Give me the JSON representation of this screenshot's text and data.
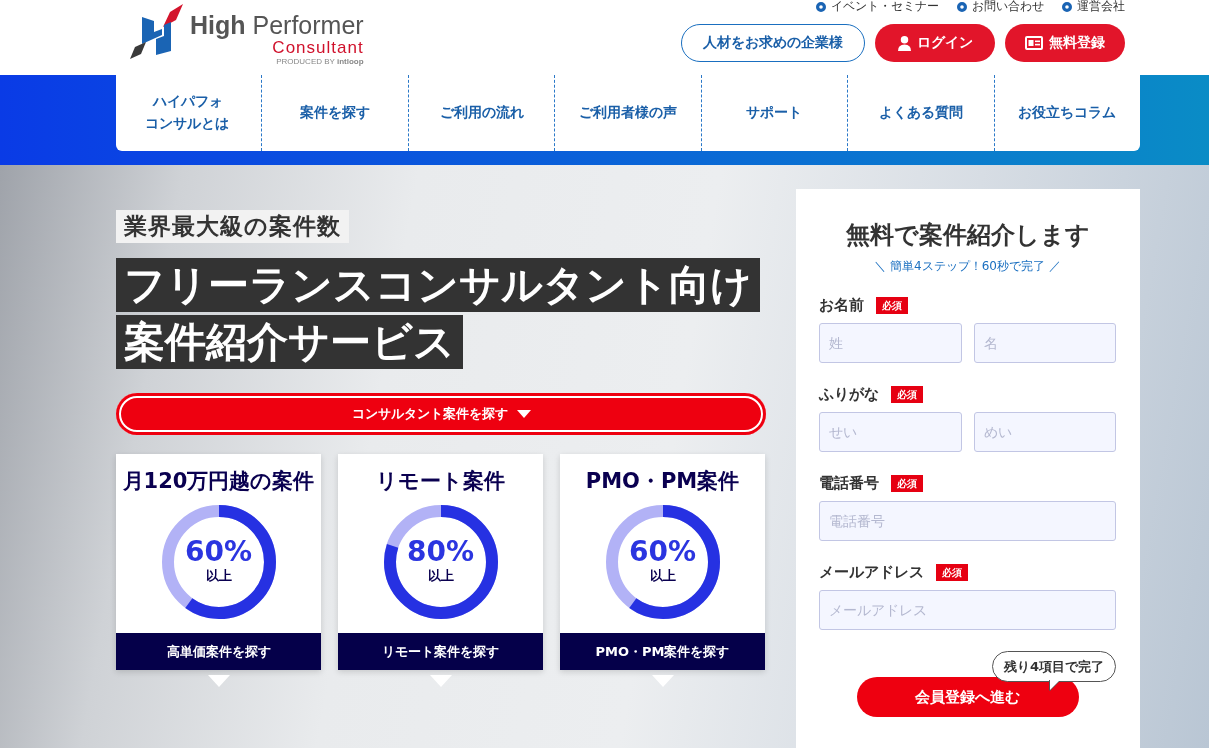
{
  "header": {
    "logo": {
      "wordmark": "**High** Performer",
      "tagline": "Consultant",
      "credit": "PRODUCED BY **intloop**"
    },
    "utility_links": [
      "イベント・セミナー",
      "お問い合わせ",
      "運営会社"
    ],
    "buttons": [
      {
        "label": "人材をお求めの企業様",
        "kind": "outline"
      },
      {
        "label": "ログイン",
        "kind": "login"
      },
      {
        "label": "無料登録",
        "kind": "register"
      }
    ]
  },
  "nav": {
    "items": [
      "ハイパフォコンサルとは",
      "案件を探す",
      "ご利用の流れ",
      "ご利用者様の声",
      "サポート",
      "よくある質問",
      "お役立ちコラム"
    ]
  },
  "hero": {
    "tag": "業界最大級の案件数",
    "headline_lines": [
      "フリーランスコンサルタント向け",
      "案件紹介サービス"
    ],
    "cta": "コンサルタント案件を探す",
    "cards": [
      {
        "title": "月**120**万円越の案件",
        "level": 0.6,
        "percent": "60%",
        "suffix": "以上",
        "link": "高単価案件を探す"
      },
      {
        "title": "リモート案件",
        "level": 0.8,
        "percent": "80%",
        "suffix": "以上",
        "link": "リモート案件を探す"
      },
      {
        "title": "PMO・PM案件",
        "level": 0.6,
        "percent": "60%",
        "suffix": "以上",
        "link": "PMO・PM案件を探す"
      }
    ]
  },
  "form": {
    "title": "無料で案件紹介します",
    "subtitle": "＼ 簡単4ステップ！60秒で完了 ／",
    "fields": [
      {
        "label": "お名前",
        "badge": "必須",
        "inputs": [
          {
            "placeholder": "姓"
          },
          {
            "placeholder": "名"
          }
        ]
      },
      {
        "label": "ふりがな",
        "badge": "必須",
        "inputs": [
          {
            "placeholder": "せい"
          },
          {
            "placeholder": "めい"
          }
        ]
      },
      {
        "label": "電話番号",
        "badge": "必須",
        "inputs": [
          {
            "placeholder": "電話番号"
          }
        ]
      },
      {
        "label": "メールアドレス",
        "badge": "必須",
        "inputs": [
          {
            "placeholder": "メールアドレス"
          }
        ]
      }
    ],
    "progress_note": "残り**4**項目で完了",
    "submit": "会員登録へ進む"
  }
}
